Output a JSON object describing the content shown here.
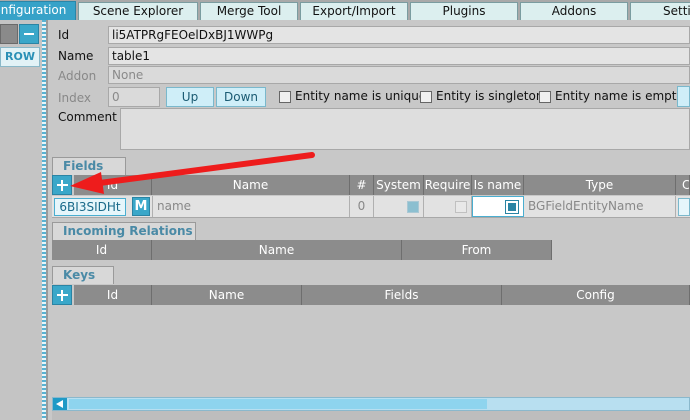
{
  "tabs": [
    {
      "label": "Configuration"
    },
    {
      "label": "Scene Explorer"
    },
    {
      "label": "Merge Tool"
    },
    {
      "label": "Export/Import"
    },
    {
      "label": "Plugins"
    },
    {
      "label": "Addons"
    },
    {
      "label": "Setti"
    }
  ],
  "left": {
    "row_label": "ROW"
  },
  "meta": {
    "id_label": "Id",
    "id_value": "li5ATPRgFEOelDxBJ1WWPg",
    "name_label": "Name",
    "name_value": "table1",
    "addon_label": "Addon",
    "addon_value": "None",
    "index_label": "Index",
    "index_value": "0",
    "up_label": "Up",
    "down_label": "Down",
    "unique_label": "Entity name is unique",
    "singleton_label": "Entity is singleton",
    "empty_label": "Entity name is empty",
    "comment_label": "Comment"
  },
  "fields": {
    "section": "Fields",
    "headers": [
      "Id",
      "Name",
      "#",
      "System",
      "Require",
      "Is name",
      "Type",
      "C"
    ],
    "row": {
      "id": "6BI3SIDHt",
      "m_badge": "M",
      "name": "name",
      "index": "0",
      "type": "BGFieldEntityName",
      "system": true,
      "require": false,
      "is_name": true
    }
  },
  "incoming": {
    "section": "Incoming Relations",
    "headers": [
      "Id",
      "Name",
      "From"
    ]
  },
  "keys": {
    "section": "Keys",
    "headers": [
      "Id",
      "Name",
      "Fields",
      "Config"
    ]
  },
  "colors": {
    "accent": "#36a2c8",
    "arrow": "#ee1c1c"
  }
}
